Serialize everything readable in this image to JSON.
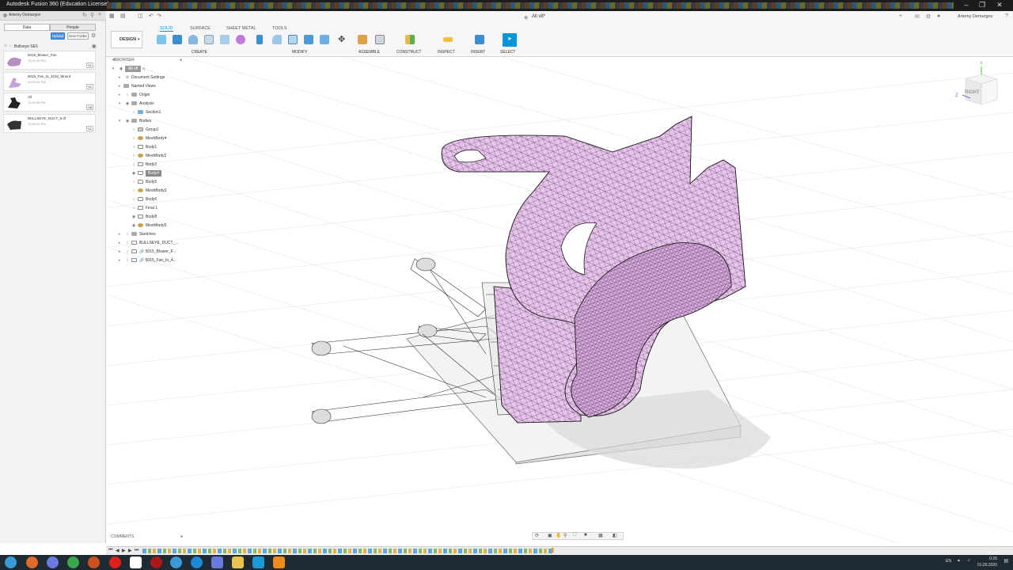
{
  "window": {
    "title": "Autodesk Fusion 360 (Education License)",
    "doc_tab": "All v8*",
    "user": "Artemy Demurgov"
  },
  "data_panel": {
    "user": "Artemy Demurgov",
    "tabs": [
      "Data",
      "People"
    ],
    "upload": "Upload",
    "new_folder": "New Folder",
    "project": "Bullseye SE5",
    "files": [
      {
        "name": "5015_Blower_Fan",
        "time": "10:24:16 PM",
        "ver": "V1"
      },
      {
        "name": "5015_Fan_to_4010_Mount",
        "time": "10:00:28 PM",
        "ver": "V1"
      },
      {
        "name": "All",
        "time": "11:20:05 PM",
        "ver": "V8"
      },
      {
        "name": "BULLSEYE_DUCT_5.2f",
        "time": "10:30:44 PM",
        "ver": "V1"
      }
    ]
  },
  "toolbar": {
    "design": "DESIGN",
    "tabs": [
      "SOLID",
      "SURFACE",
      "SHEET METAL",
      "TOOLS"
    ],
    "groups": [
      "CREATE",
      "MODIFY",
      "ASSEMBLE",
      "CONSTRUCT",
      "INSPECT",
      "INSERT",
      "SELECT"
    ]
  },
  "browser": {
    "header": "BROWSER",
    "root": "All v8",
    "items": [
      "Document Settings",
      "Named Views",
      "Origin",
      "Analysis",
      "Section1",
      "Bodies",
      "Group1",
      "MeshBody4",
      "Body1",
      "MeshBody2",
      "Body2",
      "Body4",
      "Body5",
      "MeshBody3",
      "Body6",
      "Final 1",
      "Body8",
      "MeshBody5",
      "Sketches",
      "BULLSEYE_DUCT_...",
      "5015_Blower_F...",
      "5015_Fan_to_4..."
    ]
  },
  "viewcube": {
    "face": "RIGHT",
    "axis_y": "Y",
    "axis_z": "Z"
  },
  "comments": "COMMENTS",
  "taskbar": {
    "lang": "EN",
    "time": "0:26",
    "date": "01.05.2020"
  },
  "colors": {
    "model": "#e6c5ea",
    "accent": "#0696d7",
    "taskbar": "#1f2a33"
  }
}
